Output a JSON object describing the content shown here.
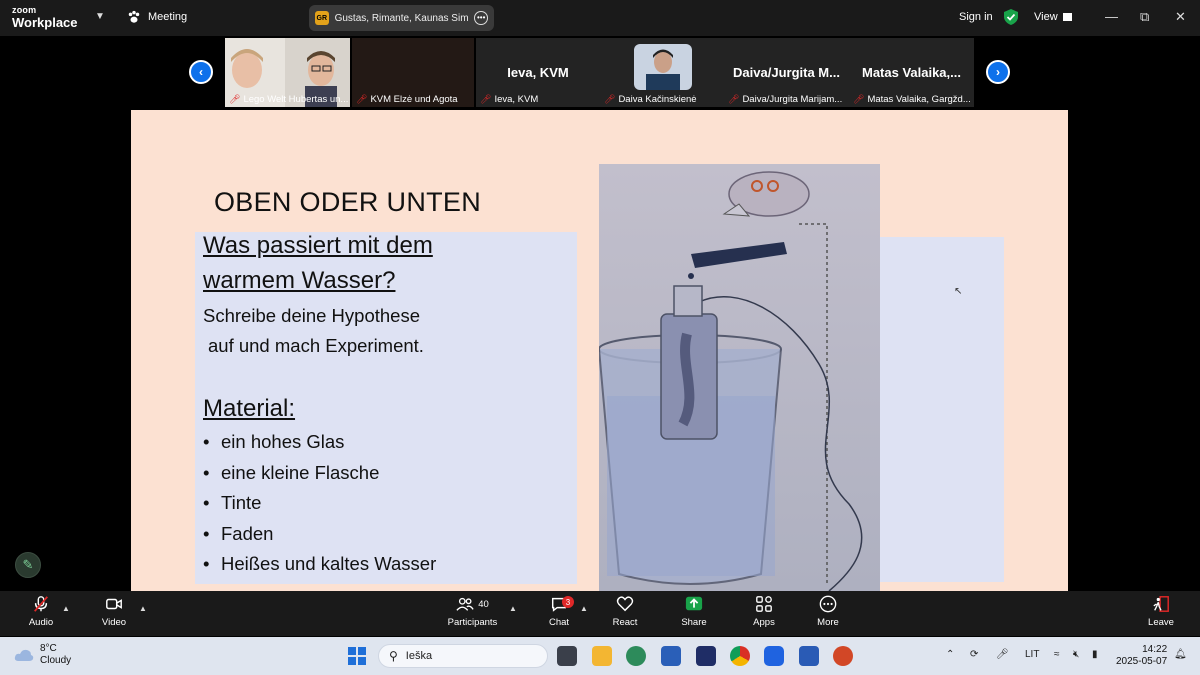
{
  "zoom": {
    "logo_line1": "zoom",
    "logo_line2": "Workplace",
    "meeting_label": "Meeting",
    "title_badge": "GR",
    "title_text": "Gustas, Rimante, Kaunas Simonas",
    "sign_in": "Sign in",
    "view": "View",
    "accent_color": "#0e71eb"
  },
  "participants_strip": [
    {
      "name": "Lego Welt Hubertas un..."
    },
    {
      "name": "KVM Elzė und Agota"
    },
    {
      "name": "Ieva, KVM",
      "big": "Ieva, KVM"
    },
    {
      "name": "Daiva Kačinskienė"
    },
    {
      "name": "Daiva/Jurgita Marijam...",
      "big": "Daiva/Jurgita  M..."
    },
    {
      "name": "Matas Valaika, Gargžd...",
      "big": "Matas  Valaika,..."
    }
  ],
  "slide": {
    "title": "OBEN ODER UNTEN",
    "question_line1": "Was passiert mit dem",
    "question_line2": "warmem Wasser?",
    "hypothesis_line1": "Schreibe deine Hypothese",
    "hypothesis_line2": "auf und mach Experiment.",
    "material_heading": "Material:",
    "materials": [
      "ein hohes Glas",
      "eine kleine Flasche",
      "Tinte",
      "Faden",
      "Heißes und kaltes Wasser"
    ],
    "bullet": "•"
  },
  "toolbar": {
    "audio": "Audio",
    "video": "Video",
    "participants": "Participants",
    "participants_count": "40",
    "chat": "Chat",
    "chat_badge": "3",
    "react": "React",
    "share": "Share",
    "apps": "Apps",
    "more": "More",
    "leave": "Leave"
  },
  "taskbar": {
    "temp": "8°C",
    "condition": "Cloudy",
    "search_text": "Ieška",
    "lang": "LIT",
    "time": "14:22",
    "date": "2025-05-07"
  }
}
